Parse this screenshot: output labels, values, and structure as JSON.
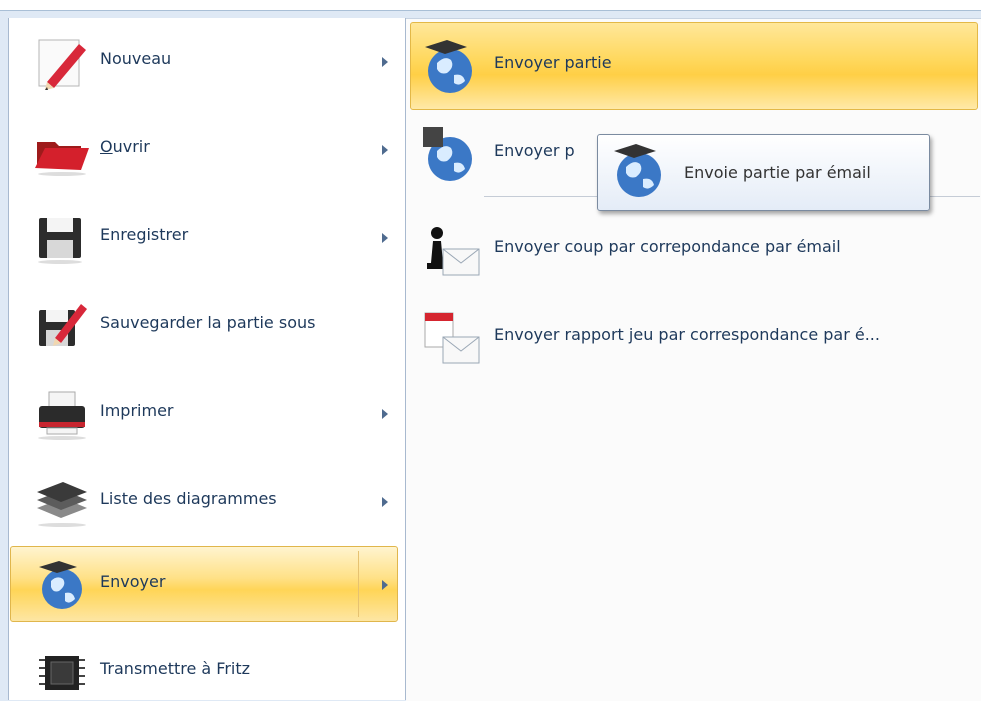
{
  "left_menu": {
    "items": [
      {
        "label": "Nouveau",
        "icon": "pencil-new-icon",
        "submenu": true
      },
      {
        "label": "Ouvrir",
        "icon": "folder-open-icon",
        "submenu": true,
        "underline_first": true
      },
      {
        "label": "Enregistrer",
        "icon": "floppy-disk-icon",
        "submenu": true
      },
      {
        "label": "Sauvegarder la partie sous",
        "icon": "save-as-icon",
        "submenu": false
      },
      {
        "label": "Imprimer",
        "icon": "printer-icon",
        "submenu": true
      },
      {
        "label": "Liste des diagrammes",
        "icon": "chessboards-icon",
        "submenu": true
      },
      {
        "label": "Envoyer",
        "icon": "globe-board-icon",
        "submenu": true,
        "selected": true
      },
      {
        "label": "Transmettre à Fritz",
        "icon": "chip-icon",
        "submenu": false
      }
    ]
  },
  "submenu": {
    "items": [
      {
        "label": "Envoyer partie",
        "icon": "globe-board-icon",
        "hovered": true
      },
      {
        "label": "Envoyer p",
        "icon": "globe-board-icon"
      },
      {
        "label": "Envoyer coup par correpondance par émail",
        "icon": "pawn-envelope-icon"
      },
      {
        "label": "Envoyer rapport jeu par correspondance par é...",
        "icon": "pdf-envelope-icon"
      }
    ]
  },
  "tooltip": {
    "text": "Envoie partie par émail",
    "icon": "globe-board-icon"
  },
  "colors": {
    "selection_gold": "#ffd557",
    "menu_text": "#1e395b",
    "pane_border": "#a8b9cf"
  }
}
